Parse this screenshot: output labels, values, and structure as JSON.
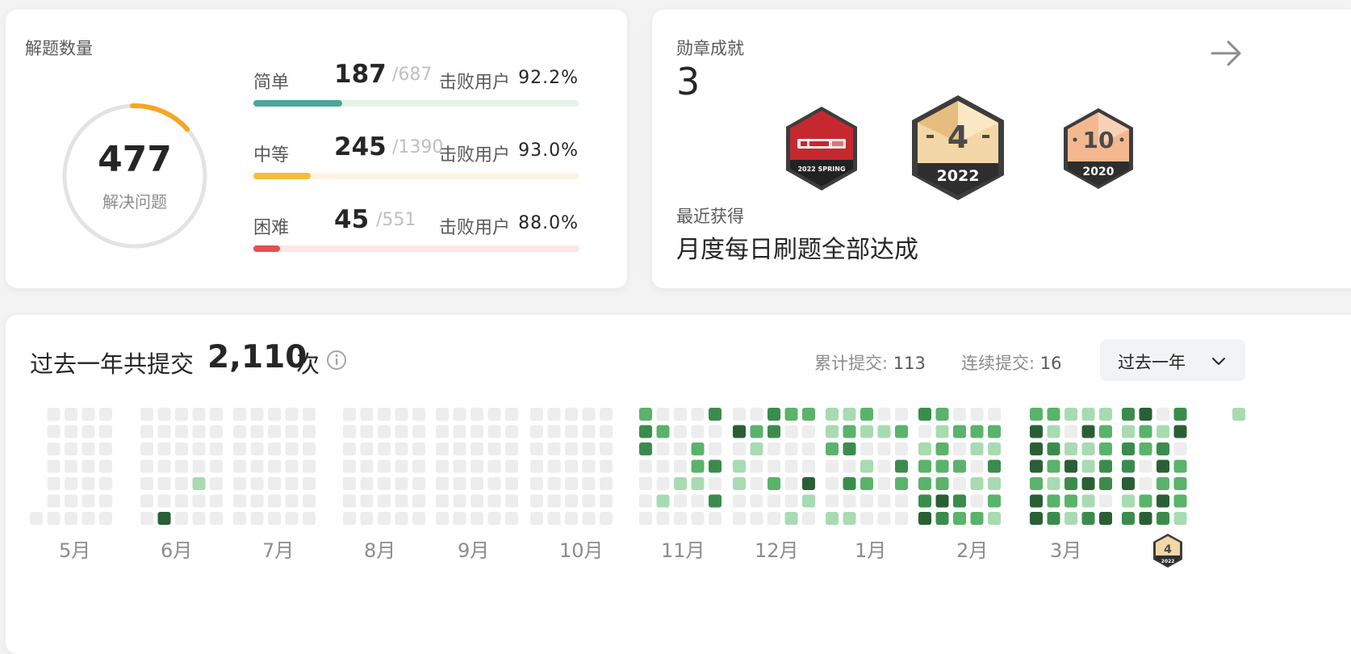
{
  "solved": {
    "title": "解题数量",
    "total": "477",
    "total_label": "解决问题",
    "ring_progress": 0.14,
    "difficulties": [
      {
        "name": "简单",
        "solved": "187",
        "total": "/687",
        "beat_label": "击败用户",
        "beat": "92.2%",
        "progress": 0.272,
        "color": "#4ba79b",
        "track": "#e5f3e6"
      },
      {
        "name": "中等",
        "solved": "245",
        "total": "/1390",
        "beat_label": "击败用户",
        "beat": "93.0%",
        "progress": 0.176,
        "color": "#f7bd3a",
        "track": "#fdf4e2"
      },
      {
        "name": "困难",
        "solved": "45",
        "total": "/551",
        "beat_label": "击败用户",
        "beat": "88.0%",
        "progress": 0.082,
        "color": "#e25050",
        "track": "#fce6e6"
      }
    ]
  },
  "badges": {
    "title": "勋章成就",
    "count": "3",
    "recent_label": "最近获得",
    "recent_name": "月度每日刷题全部达成",
    "items": [
      {
        "icon": "cmb-spring-badge-icon",
        "caption": "2022 SPRING"
      },
      {
        "icon": "monthly-4-badge-icon",
        "number": "4",
        "caption": "2022"
      },
      {
        "icon": "monthly-10-badge-icon",
        "number": "10",
        "caption": "2020"
      }
    ]
  },
  "submissions": {
    "prefix": "过去一年共提交",
    "count": "2,110",
    "suffix": "次",
    "total_label": "累计提交:",
    "total_value": "113",
    "streak_label": "连续提交:",
    "streak_value": "16",
    "range": "过去一年",
    "months": [
      "5月",
      "6月",
      "7月",
      "8月",
      "9月",
      "10月",
      "11月",
      "12月",
      "1月",
      "2月",
      "3月"
    ],
    "current_badge": {
      "number": "4",
      "caption": "2022"
    }
  },
  "colors": {
    "empty": "#ededed",
    "level1": "#a8dbb1",
    "level2": "#5ab36a",
    "level3": "#3b8c4c",
    "level4": "#2a5f35"
  }
}
